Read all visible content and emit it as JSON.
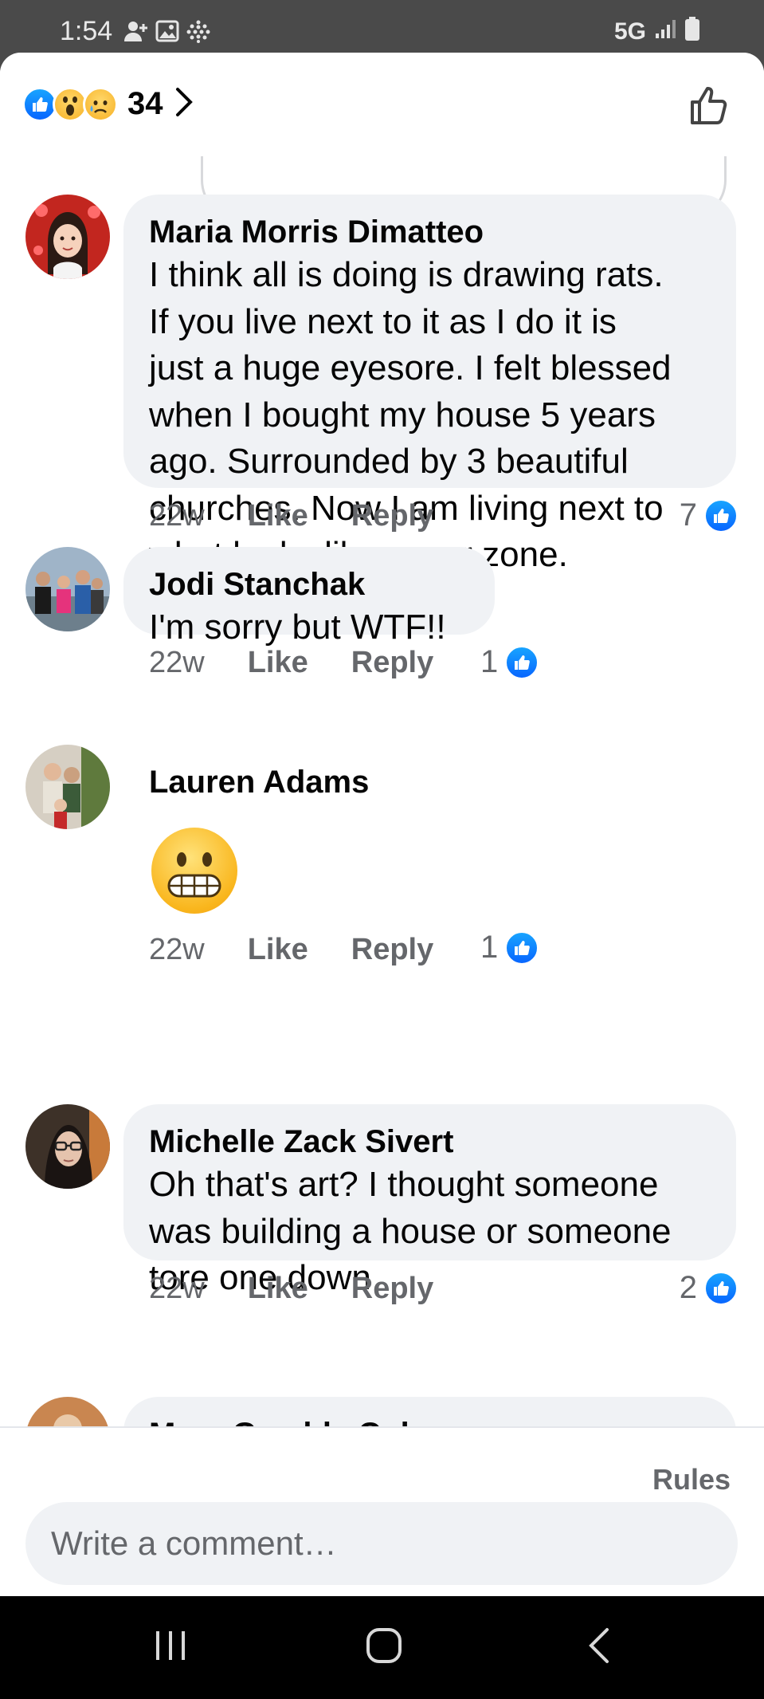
{
  "status_bar": {
    "time": "1:54",
    "network": "5G",
    "icons": [
      "add-person-icon",
      "image-icon",
      "grid-dots-icon",
      "signal-icon",
      "battery-icon"
    ]
  },
  "header": {
    "reaction_count": "34",
    "reactions": [
      "like",
      "wow",
      "sad"
    ]
  },
  "comments": [
    {
      "author": "Maria Morris Dimatteo",
      "text": "I think all is doing is drawing rats.\nIf you live next to it as I do it is\njust a huge eyesore.  I felt blessed\nwhen I bought my house 5 years\nago.  Surrounded by 3 beautiful\nchurches. Now I am living next to\nwhat looks like a war zone.",
      "time": "22w",
      "like_label": "Like",
      "reply_label": "Reply",
      "likes": "7"
    },
    {
      "author": "Jodi Stanchak",
      "text": "I'm sorry but WTF!!",
      "time": "22w",
      "like_label": "Like",
      "reply_label": "Reply",
      "likes": "1"
    },
    {
      "author": "Lauren Adams",
      "emoji": "grimacing-face",
      "time": "22w",
      "like_label": "Like",
      "reply_label": "Reply",
      "likes": "1"
    },
    {
      "author": "Michelle Zack Sivert",
      "text": "Oh that's art? I thought someone\nwas building a house or someone\ntore one down",
      "time": "22w",
      "like_label": "Like",
      "reply_label": "Reply",
      "likes": "2"
    },
    {
      "author": "Mary Gamble Cole"
    }
  ],
  "composer": {
    "rules_label": "Rules",
    "placeholder": "Write a comment…"
  },
  "colors": {
    "like_blue": "#0866ff",
    "bubble_bg": "#f0f2f5",
    "secondary_text": "#65676b"
  }
}
